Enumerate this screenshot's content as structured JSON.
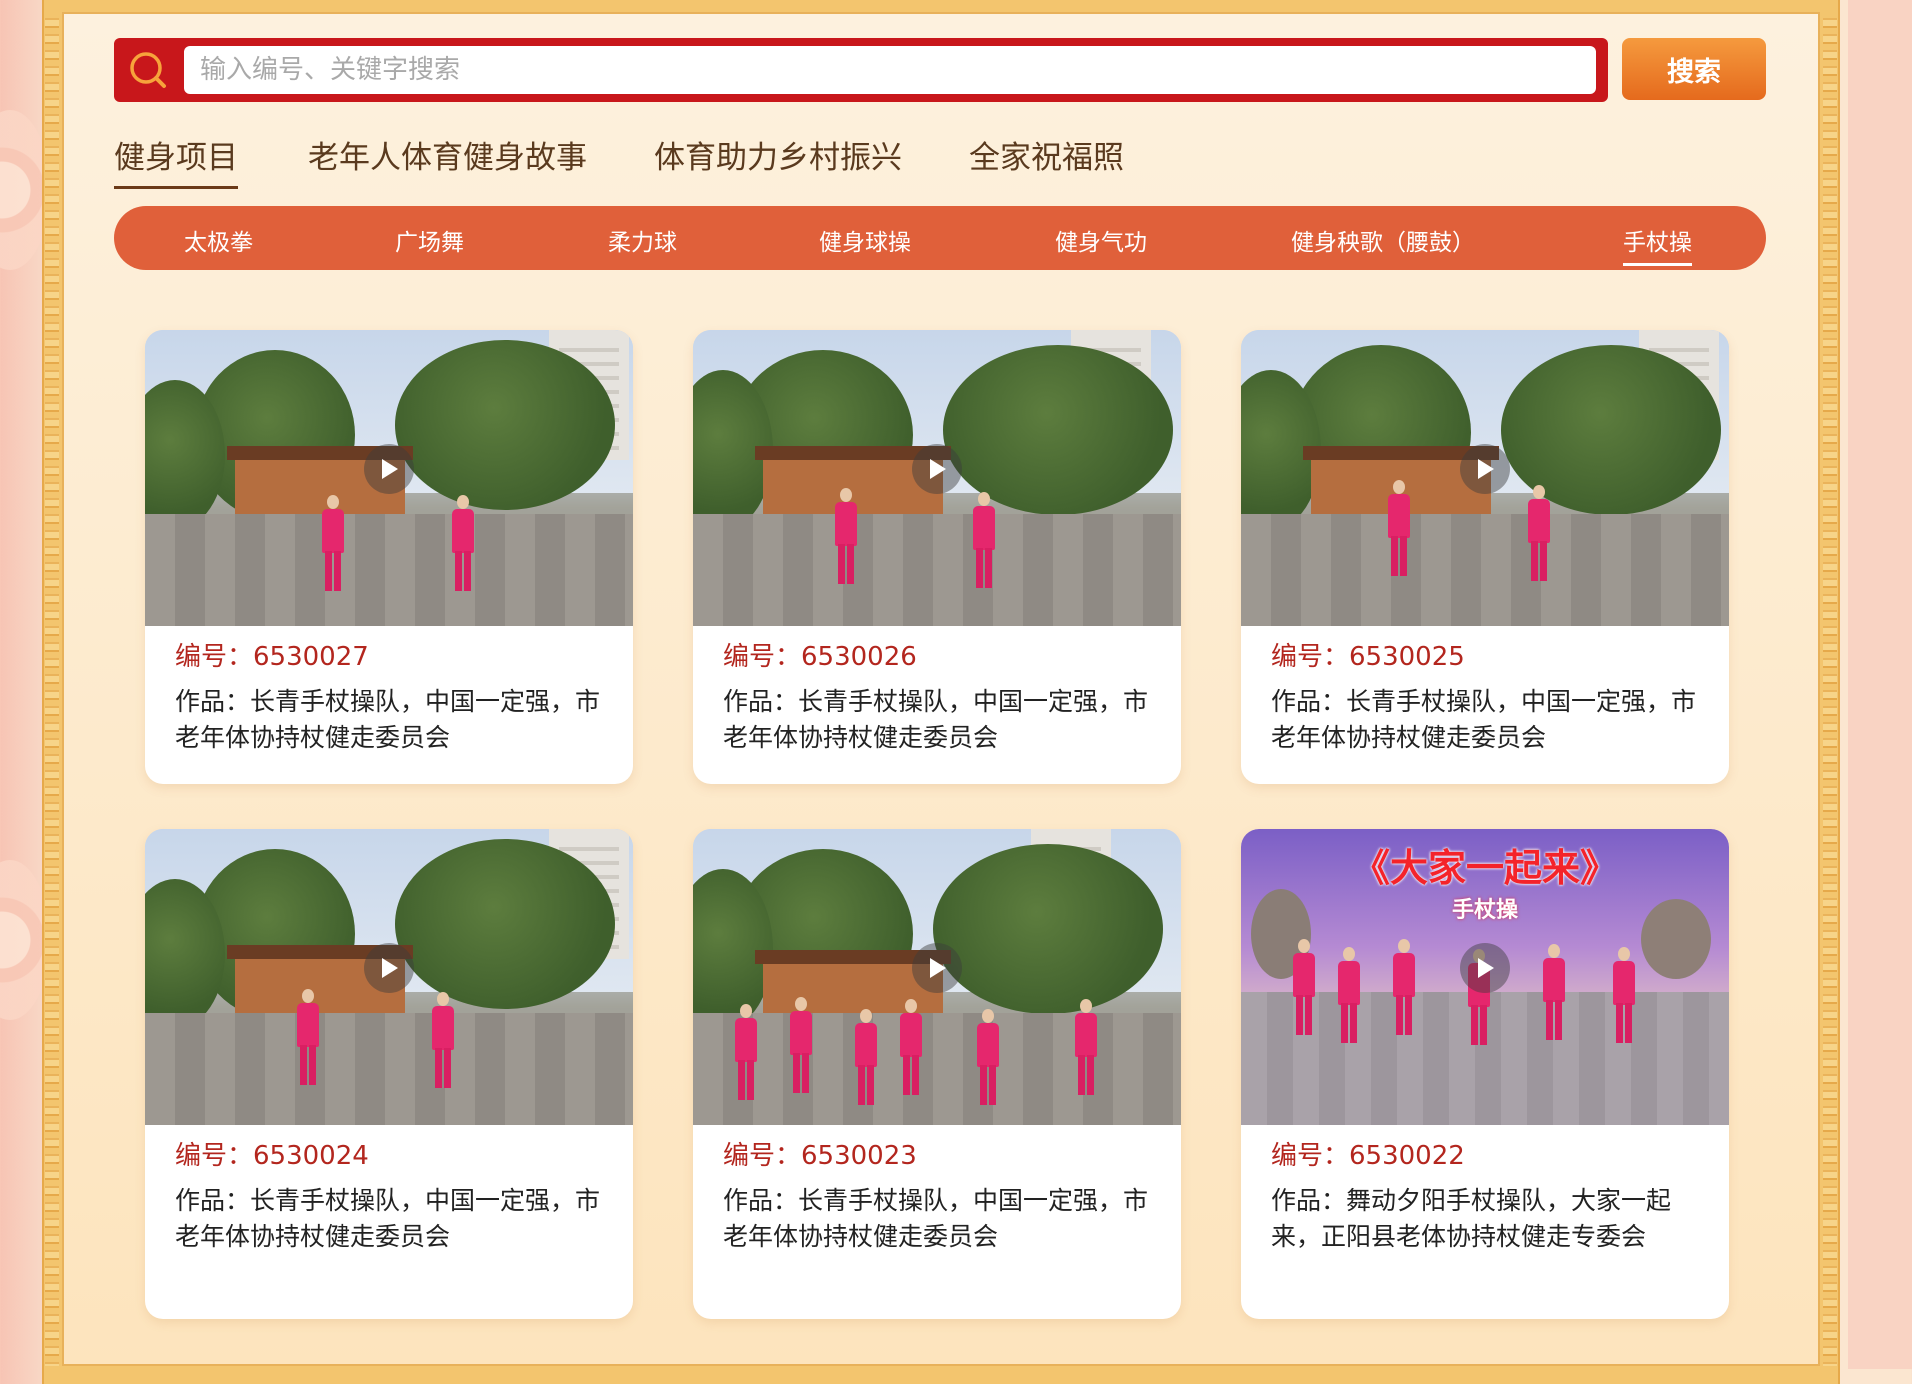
{
  "search": {
    "placeholder": "输入编号、关键字搜索",
    "button_label": "搜索"
  },
  "categories": [
    {
      "label": "健身项目",
      "active": true
    },
    {
      "label": "老年人体育健身故事",
      "active": false
    },
    {
      "label": "体育助力乡村振兴",
      "active": false
    },
    {
      "label": "全家祝福照",
      "active": false
    }
  ],
  "sub_nav": [
    {
      "label": "太极拳",
      "active": false
    },
    {
      "label": "广场舞",
      "active": false
    },
    {
      "label": "柔力球",
      "active": false
    },
    {
      "label": "健身球操",
      "active": false
    },
    {
      "label": "健身气功",
      "active": false
    },
    {
      "label": "健身秧歌（腰鼓）",
      "active": false
    },
    {
      "label": "手杖操",
      "active": true
    }
  ],
  "cards": [
    {
      "id_text": "编号：6530027",
      "desc": "作品：长青手杖操队，中国一定强，市老年体协持杖健走委员会"
    },
    {
      "id_text": "编号：6530026",
      "desc": "作品：长青手杖操队，中国一定强，市老年体协持杖健走委员会"
    },
    {
      "id_text": "编号：6530025",
      "desc": "作品：长青手杖操队，中国一定强，市老年体协持杖健走委员会"
    },
    {
      "id_text": "编号：6530024",
      "desc": "作品：长青手杖操队，中国一定强，市老年体协持杖健走委员会"
    },
    {
      "id_text": "编号：6530023",
      "desc": "作品：长青手杖操队，中国一定强，市老年体协持杖健走委员会"
    },
    {
      "id_text": "编号：6530022",
      "desc": "作品：舞动夕阳手杖操队，大家一起来，正阳县老体协持杖健走专委会",
      "banner_title": "《大家一起来》",
      "banner_sub": "手杖操"
    }
  ],
  "colors": {
    "brand_red": "#c8171b",
    "accent_orange": "#e0603a",
    "id_text": "#b3261e"
  }
}
